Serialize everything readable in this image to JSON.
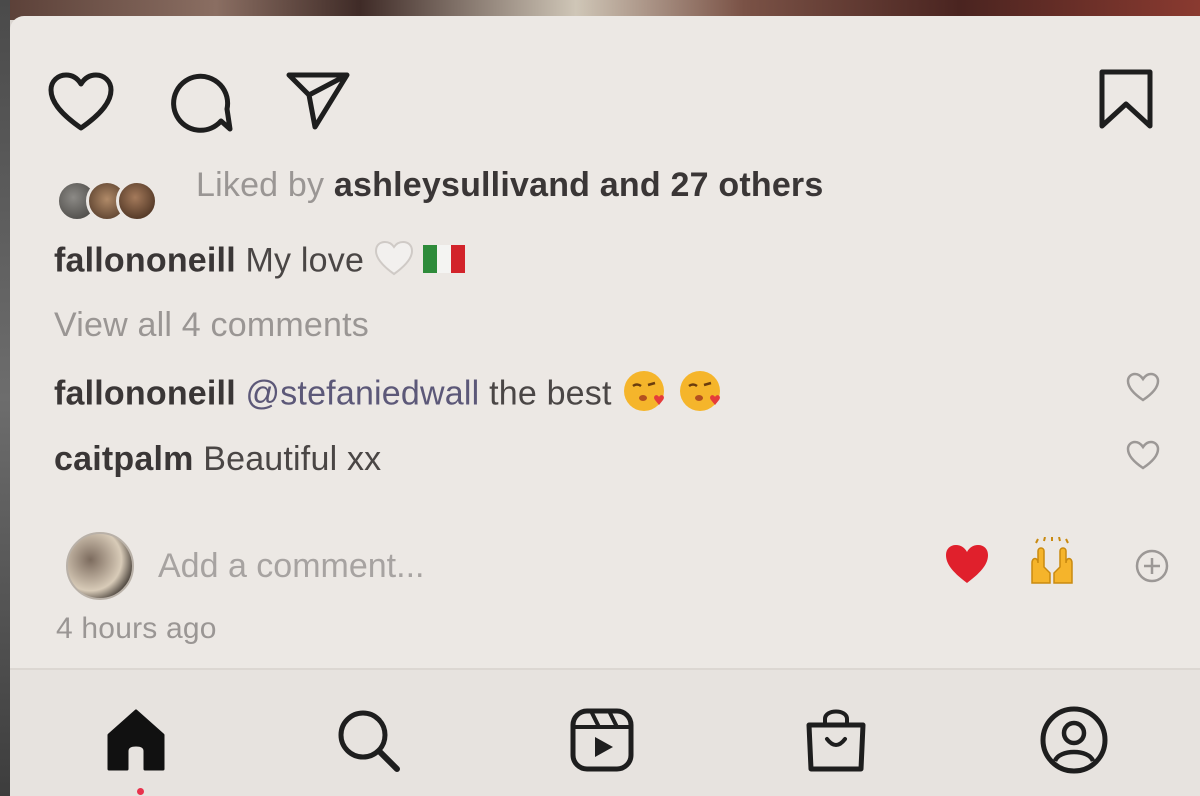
{
  "post": {
    "likes_prefix": "Liked by",
    "likes_user": "ashleysullivand",
    "likes_and": "and",
    "likes_others": "27 others",
    "caption_user": "fallononeill",
    "caption_text": "My love",
    "caption_emojis": [
      "white-heart",
      "italy-flag"
    ],
    "view_comments": "View all 4 comments",
    "comments": [
      {
        "user": "fallononeill",
        "mention": "@stefaniedwall",
        "text": "the best",
        "emojis": [
          "kissing-heart-face",
          "kissing-heart-face"
        ]
      },
      {
        "user": "caitpalm",
        "mention": "",
        "text": "Beautiful xx",
        "emojis": []
      }
    ],
    "add_comment_placeholder": "Add a comment...",
    "quick_reactions": [
      "red-heart",
      "raised-hands"
    ],
    "timestamp": "4 hours ago"
  },
  "actions": [
    "heart-icon",
    "comment-icon",
    "share-icon",
    "bookmark-icon"
  ],
  "bottom_nav": [
    "home-icon",
    "search-icon",
    "reels-icon",
    "shop-icon",
    "profile-icon"
  ],
  "colors": {
    "heart_red": "#e0202c",
    "flag_green": "#2e8b3a",
    "flag_red": "#d2232a",
    "notification_dot": "#e8334d"
  }
}
